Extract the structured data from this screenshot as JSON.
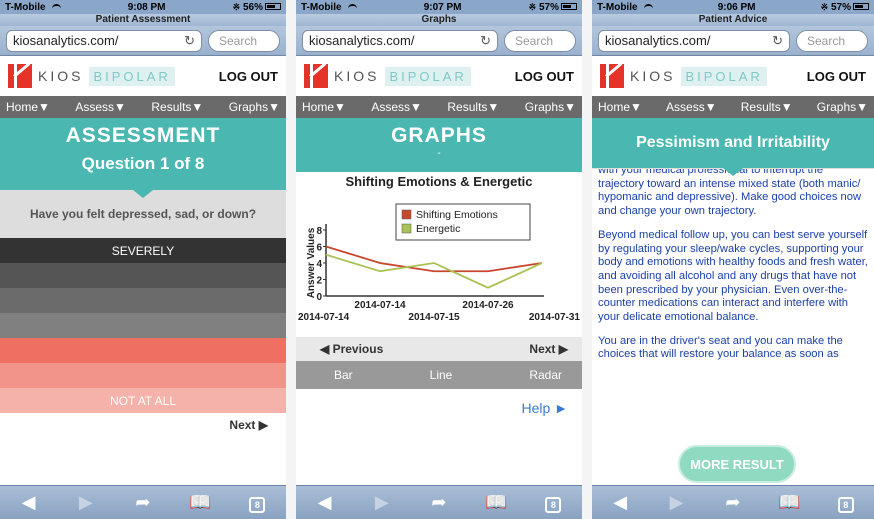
{
  "common": {
    "carrier": "T-Mobile",
    "url": "kiosanalytics.com/",
    "search_placeholder": "Search",
    "brand_kios": "KIOS",
    "brand_bipolar": "BIPOLAR",
    "logout": "LOG OUT",
    "nav": [
      "Home▼",
      "Assess▼",
      "Results▼",
      "Graphs▼"
    ],
    "tab_count": "8"
  },
  "screen1": {
    "time": "9:08 PM",
    "battery": "56%",
    "page_title": "Patient Assessment",
    "banner_title": "ASSESSMENT",
    "banner_subtitle": "Question 1 of 8",
    "question": "Have you felt depressed, sad, or down?",
    "options": [
      {
        "label": "SEVERELY",
        "color": "#333333"
      },
      {
        "label": "",
        "color": "#555555"
      },
      {
        "label": "",
        "color": "#6b6b6b"
      },
      {
        "label": "",
        "color": "#808080"
      },
      {
        "label": "",
        "color": "#ef6f62"
      },
      {
        "label": "",
        "color": "#f2948a"
      },
      {
        "label": "NOT AT ALL",
        "color": "#f4b2aa"
      }
    ],
    "next": "Next ▶"
  },
  "screen2": {
    "time": "9:07 PM",
    "battery": "57%",
    "page_title": "Graphs",
    "banner_title": "GRAPHS",
    "banner_subtitle": "-",
    "prev": "◀ Previous",
    "next": "Next ▶",
    "chart_types": [
      "Bar",
      "Line",
      "Radar"
    ],
    "help": "Help ►"
  },
  "screen3": {
    "time": "9:06 PM",
    "battery": "57%",
    "page_title": "Patient Advice",
    "banner_title": "Pessimism and Irritability",
    "paragraphs": [
      "with your medical professional to interrupt the trajectory toward an intense mixed state (both manic/ hypomanic and depressive). Make good choices now and change your own trajectory.",
      "Beyond medical follow up, you can best serve yourself by regulating your sleep/wake cycles, supporting your body and emotions with healthy foods and fresh water, and avoiding all alcohol and any drugs that have not been prescribed by your physician. Even over-the-counter medications can interact and interfere with your delicate emotional balance.",
      "You are in the driver's seat and you can make the choices that will restore your balance as soon as"
    ],
    "more_button": "MORE RESULT"
  },
  "chart_data": {
    "type": "line",
    "title": "Shifting Emotions & Energetic",
    "xlabel": "",
    "ylabel": "Answer Values",
    "ylim": [
      0,
      8
    ],
    "yticks": [
      0,
      2,
      4,
      6,
      8
    ],
    "x": [
      "2014-07-14",
      "2014-07-14",
      "2014-07-15",
      "2014-07-26",
      "2014-07-31"
    ],
    "x_tick_labels_upper": [
      "2014-07-14",
      "2014-07-26"
    ],
    "x_tick_labels_lower": [
      "2014-07-14",
      "2014-07-15",
      "2014-07-31"
    ],
    "series": [
      {
        "name": "Shifting Emotions",
        "color": "#c8472f",
        "values": [
          6,
          4,
          3,
          3,
          4
        ]
      },
      {
        "name": "Energetic",
        "color": "#a9c255",
        "values": [
          5,
          3,
          4,
          1,
          4
        ]
      }
    ],
    "legend": "top-right"
  }
}
